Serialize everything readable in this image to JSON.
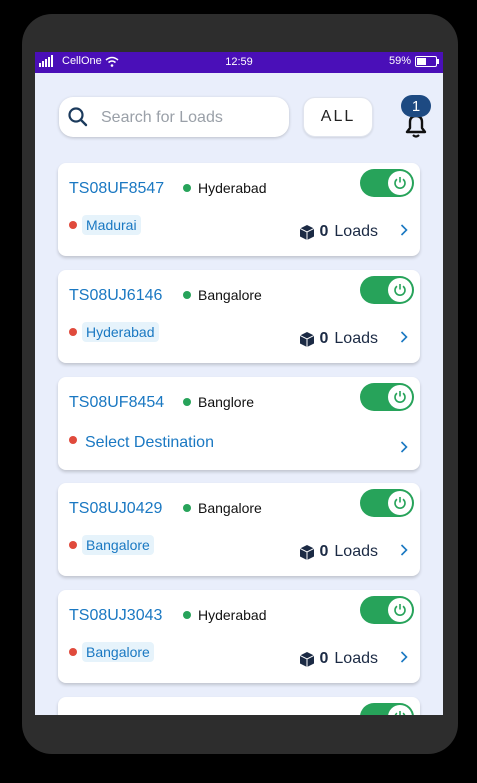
{
  "status_bar": {
    "carrier": "CellOne",
    "time": "12:59",
    "battery": "59%",
    "battery_level": 0.59
  },
  "search": {
    "placeholder": "Search for Loads",
    "value": ""
  },
  "filter": {
    "label": "ALL"
  },
  "notifications": {
    "count": "1"
  },
  "accent_colors": {
    "header": "#4a0fb8",
    "link": "#1a78c2",
    "active": "#27a35a",
    "destination_dot": "#e04a3c",
    "badge": "#1d4a82"
  },
  "vehicles": [
    {
      "plate": "TS08UF8547",
      "origin": "Hyderabad",
      "destination": "Madurai",
      "loads_count": "0",
      "loads_label": "Loads"
    },
    {
      "plate": "TS08UJ6146",
      "origin": "Bangalore",
      "destination": "Hyderabad",
      "loads_count": "0",
      "loads_label": "Loads"
    },
    {
      "plate": "TS08UF8454",
      "origin": "Banglore",
      "destination_prompt": "Select Destination"
    },
    {
      "plate": "TS08UJ0429",
      "origin": "Bangalore",
      "destination": "Bangalore",
      "loads_count": "0",
      "loads_label": "Loads"
    },
    {
      "plate": "TS08UJ3043",
      "origin": "Hyderabad",
      "destination": "Bangalore",
      "loads_count": "0",
      "loads_label": "Loads"
    },
    {}
  ]
}
